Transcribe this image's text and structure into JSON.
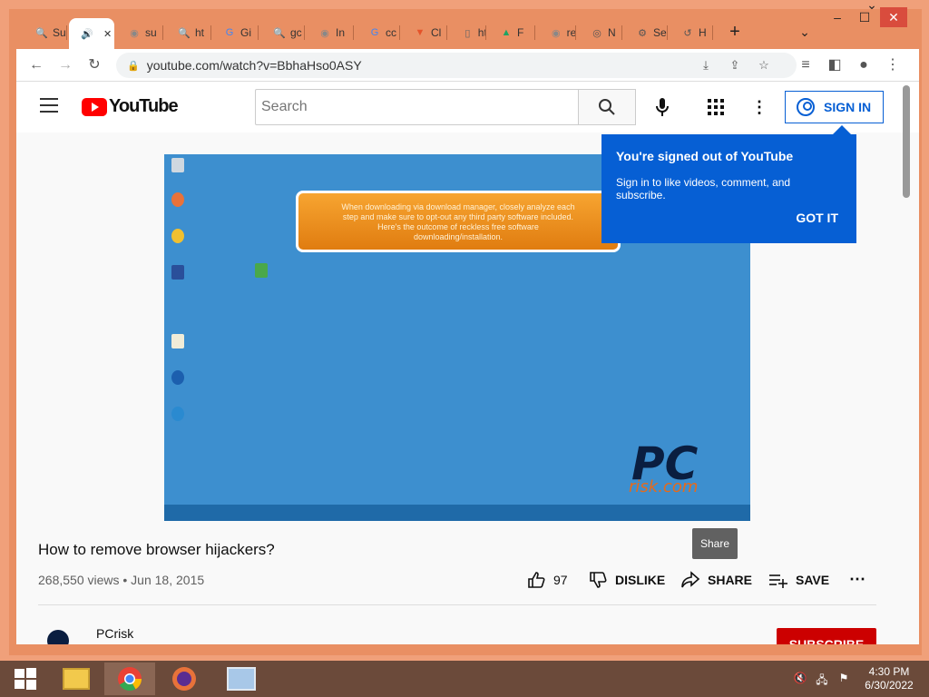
{
  "browser": {
    "tabs": [
      {
        "label": "Su",
        "icon": "search-icon"
      },
      {
        "label": "",
        "icon": "speaker-icon",
        "active": true
      },
      {
        "label": "su",
        "icon": "globe-icon"
      },
      {
        "label": "ht",
        "icon": "search-icon"
      },
      {
        "label": "Gi",
        "icon": "google-icon"
      },
      {
        "label": "gc",
        "icon": "search-icon"
      },
      {
        "label": "In",
        "icon": "globe-icon"
      },
      {
        "label": "cc",
        "icon": "google-icon"
      },
      {
        "label": "Cl",
        "icon": "brave-icon"
      },
      {
        "label": "ht",
        "icon": "page-icon"
      },
      {
        "label": "F",
        "icon": "drive-icon"
      },
      {
        "label": "re",
        "icon": "globe-icon"
      },
      {
        "label": "N",
        "icon": "chrome-icon"
      },
      {
        "label": "Se",
        "icon": "gear-icon"
      },
      {
        "label": "H",
        "icon": "history-icon"
      }
    ],
    "url": "youtube.com/watch?v=BbhaHso0ASY"
  },
  "youtube": {
    "logo_text": "YouTube",
    "search_placeholder": "Search",
    "sign_in_label": "SIGN IN",
    "popup": {
      "title": "You're signed out of YouTube",
      "body": "Sign in to like videos, comment, and subscribe.",
      "button": "GOT IT"
    },
    "video": {
      "banner_text": "When downloading via download manager, closely analyze each step and make sure to opt-out any third party software included. Here's the outcome of reckless free software downloading/installation.",
      "logo_main": "PC",
      "logo_sub": "risk.com"
    },
    "title": "How to remove browser hijackers?",
    "meta": "268,550 views • Jun 18, 2015",
    "actions": {
      "likes": "97",
      "dislike": "DISLIKE",
      "share": "SHARE",
      "save": "SAVE"
    },
    "share_tooltip": "Share",
    "channel": {
      "name": "PCrisk"
    },
    "subscribe_label": "SUBSCRIBE"
  },
  "taskbar": {
    "time": "4:30 PM",
    "date": "6/30/2022"
  }
}
